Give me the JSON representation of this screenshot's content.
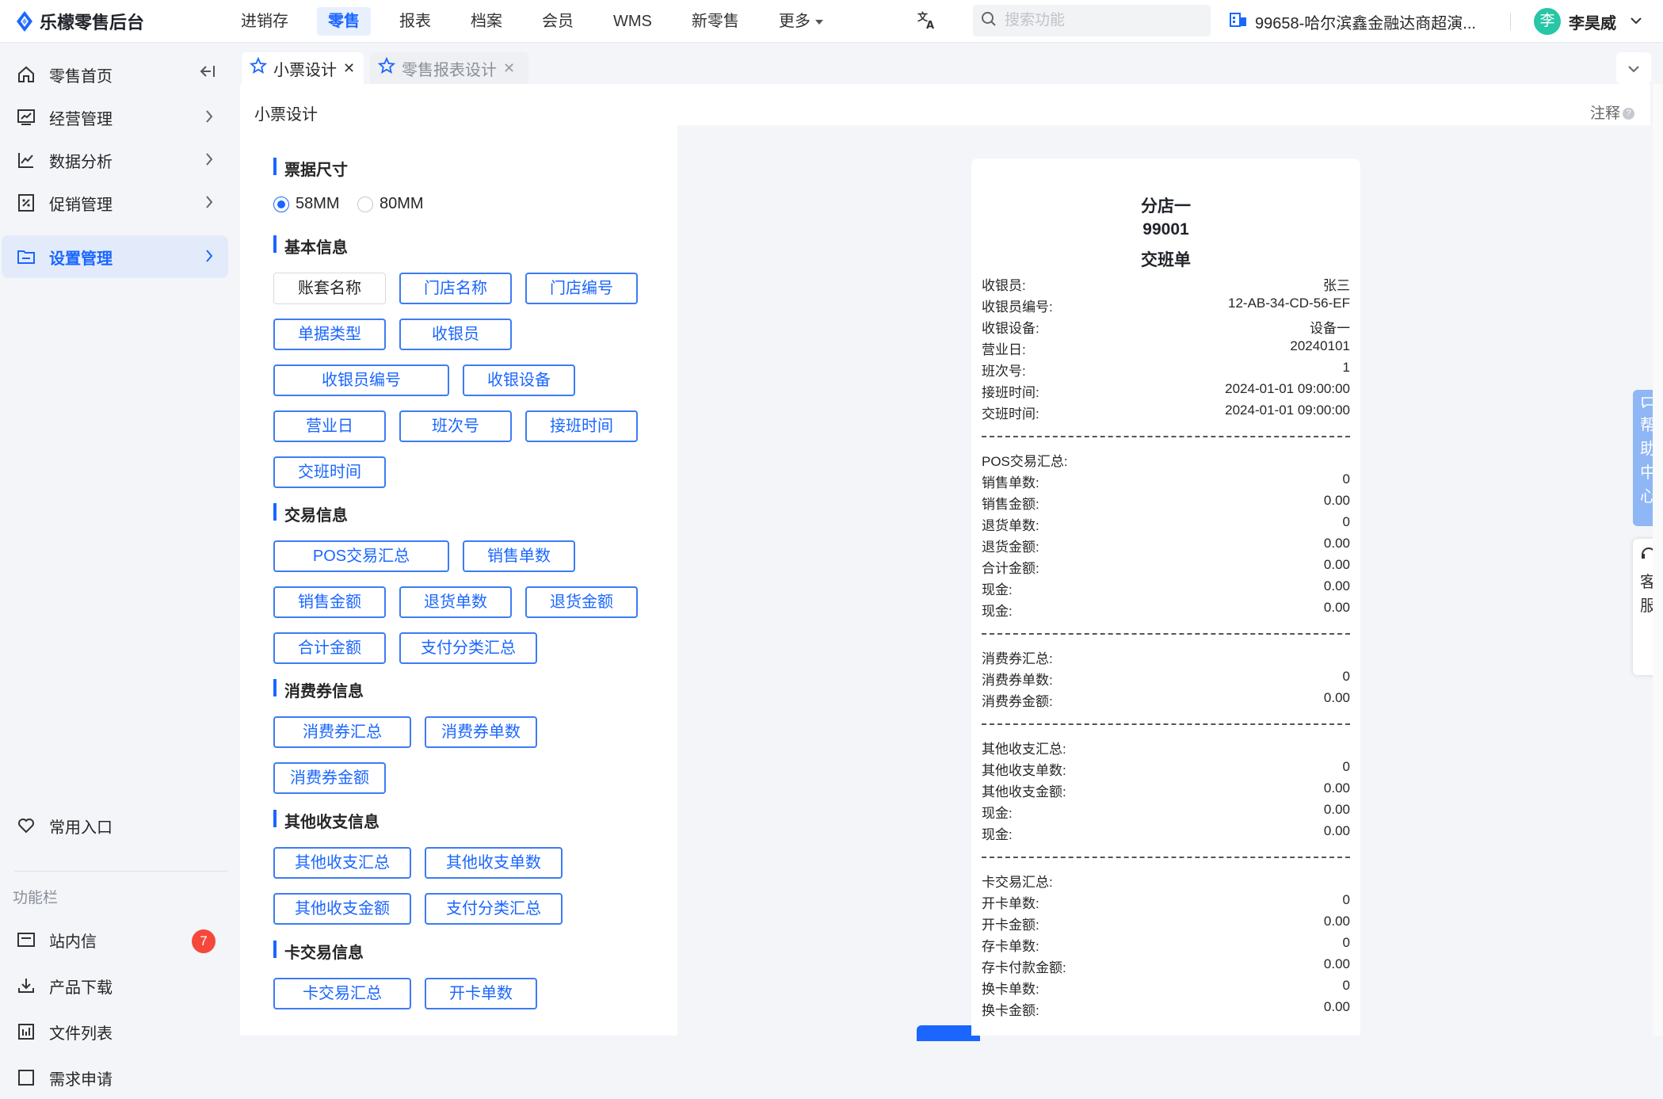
{
  "app": {
    "name": "乐檬零售后台",
    "brand_color": "#1a66ff"
  },
  "nav": {
    "items": [
      "进销存",
      "零售",
      "报表",
      "档案",
      "会员",
      "WMS",
      "新零售",
      "更多"
    ],
    "active": "零售"
  },
  "search": {
    "placeholder": "搜索功能",
    "value": ""
  },
  "store": {
    "name": "99658-哈尔滨鑫金融达商超演..."
  },
  "user": {
    "avatar_char": "李",
    "name": "李昊威"
  },
  "sidebar": {
    "items": [
      {
        "label": "零售首页",
        "icon": "home-icon"
      },
      {
        "label": "经营管理",
        "icon": "chart-board-icon"
      },
      {
        "label": "数据分析",
        "icon": "line-chart-icon"
      },
      {
        "label": "促销管理",
        "icon": "promotion-icon"
      },
      {
        "label": "设置管理",
        "icon": "folder-settings-icon"
      }
    ],
    "active": "设置管理",
    "favorites_label": "常用入口",
    "section_label": "功能栏",
    "bottom_items": [
      {
        "label": "站内信",
        "icon": "mail-icon",
        "badge": "7"
      },
      {
        "label": "产品下载",
        "icon": "download-icon"
      },
      {
        "label": "文件列表",
        "icon": "file-list-icon"
      },
      {
        "label": "需求申请",
        "icon": "request-icon"
      }
    ]
  },
  "tabs": [
    {
      "label": "小票设计",
      "active": true
    },
    {
      "label": "零售报表设计",
      "active": false
    }
  ],
  "page": {
    "title": "小票设计",
    "note": "注释",
    "note_icon": "question-icon"
  },
  "config": {
    "size_section": "票据尺寸",
    "size_options": [
      "58MM",
      "80MM"
    ],
    "size_selected": "58MM",
    "sections": [
      {
        "title": "基本信息",
        "fields": [
          "账套名称",
          "门店名称",
          "门店编号",
          "单据类型",
          "收银员",
          "收银员编号",
          "收银设备",
          "营业日",
          "班次号",
          "接班时间",
          "交班时间"
        ]
      },
      {
        "title": "交易信息",
        "fields": [
          "POS交易汇总",
          "销售单数",
          "销售金额",
          "退货单数",
          "退货金额",
          "合计金额",
          "支付分类汇总"
        ]
      },
      {
        "title": "消费券信息",
        "fields": [
          "消费券汇总",
          "消费券单数",
          "消费券金额"
        ]
      },
      {
        "title": "其他收支信息",
        "fields": [
          "其他收支汇总",
          "其他收支单数",
          "其他收支金额",
          "支付分类汇总"
        ]
      },
      {
        "title": "卡交易信息",
        "fields": [
          "卡交易汇总",
          "开卡单数"
        ]
      }
    ]
  },
  "receipt": {
    "header": [
      "分店一",
      "99001",
      "交班单"
    ],
    "basic": [
      [
        "收银员:",
        "张三"
      ],
      [
        "收银员编号:",
        "12-AB-34-CD-56-EF"
      ],
      [
        "收银设备:",
        "设备一"
      ],
      [
        "营业日:",
        "20240101"
      ],
      [
        "班次号:",
        "1"
      ],
      [
        "接班时间:",
        "2024-01-01 09:00:00"
      ],
      [
        "交班时间:",
        "2024-01-01 09:00:00"
      ]
    ],
    "pos": {
      "title": "POS交易汇总:",
      "rows": [
        [
          "销售单数:",
          "0"
        ],
        [
          "销售金额:",
          "0.00"
        ],
        [
          "退货单数:",
          "0"
        ],
        [
          "退货金额:",
          "0.00"
        ],
        [
          "合计金额:",
          "0.00"
        ],
        [
          "现金:",
          "0.00"
        ],
        [
          "现金:",
          "0.00"
        ]
      ]
    },
    "coupon": {
      "title": "消费券汇总:",
      "rows": [
        [
          "消费券单数:",
          "0"
        ],
        [
          "消费券金额:",
          "0.00"
        ]
      ]
    },
    "other": {
      "title": "其他收支汇总:",
      "rows": [
        [
          "其他收支单数:",
          "0"
        ],
        [
          "其他收支金额:",
          "0.00"
        ],
        [
          "现金:",
          "0.00"
        ],
        [
          "现金:",
          "0.00"
        ]
      ]
    },
    "card": {
      "title": "卡交易汇总:",
      "rows": [
        [
          "开卡单数:",
          "0"
        ],
        [
          "开卡金额:",
          "0.00"
        ],
        [
          "存卡单数:",
          "0"
        ],
        [
          "存卡付款金额:",
          "0.00"
        ],
        [
          "换卡单数:",
          "0"
        ],
        [
          "换卡金额:",
          "0.00"
        ]
      ]
    }
  },
  "floating": {
    "help": [
      "帮",
      "助",
      "中",
      "心"
    ],
    "service": [
      "客",
      "服"
    ]
  }
}
